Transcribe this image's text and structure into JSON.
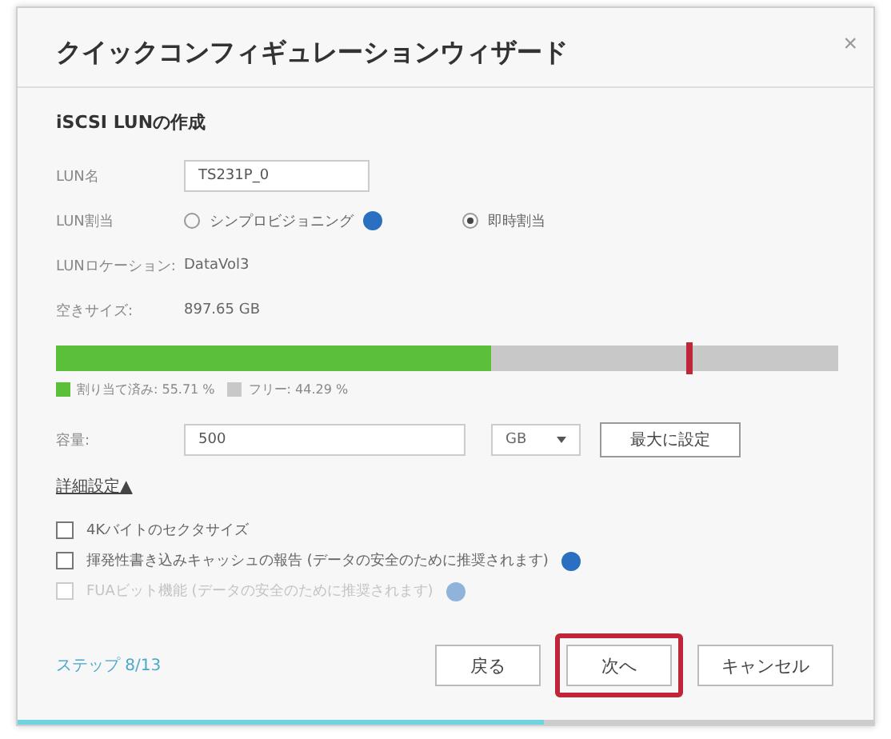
{
  "window": {
    "title": "クイックコンフィギュレーションウィザード",
    "close": "×"
  },
  "section_title": "iSCSI LUNの作成",
  "lun_name": {
    "label": "LUN名",
    "value": "TS231P_0"
  },
  "allocation": {
    "label": "LUN割当",
    "options": [
      {
        "label": "シンプロビジョニング",
        "selected": false,
        "info": true
      },
      {
        "label": "即時割当",
        "selected": true,
        "info": false
      }
    ]
  },
  "location": {
    "label": "LUNロケーション:",
    "value": "DataVol3"
  },
  "free_size": {
    "label": "空きサイズ:",
    "value": "897.65 GB"
  },
  "storage_bar": {
    "level": 0.5571,
    "marker": {
      "level": 0.805
    }
  },
  "legend": [
    {
      "label": "割り当て済み: 55.71 %",
      "color": "#5cbf3a"
    },
    {
      "label": "フリー: 44.29 %",
      "color": "#c8c8c8"
    }
  ],
  "capacity": {
    "label": "容量:",
    "value": "500",
    "unit": "GB",
    "max_button": "最大に設定"
  },
  "advanced": {
    "label": "詳細設定▲"
  },
  "options": [
    {
      "label": "4Kバイトのセクタサイズ",
      "checked": false,
      "disabled": false,
      "info": false
    },
    {
      "label": "揮発性書き込みキャッシュの報告 (データの安全のために推奨されます)",
      "checked": false,
      "disabled": false,
      "info": true
    },
    {
      "label": "FUAビット機能 (データの安全のために推奨されます)",
      "checked": false,
      "disabled": true,
      "info": true
    }
  ],
  "step": "ステップ 8/13",
  "buttons": [
    {
      "label": "戻る",
      "highlighted": false
    },
    {
      "label": "次へ",
      "highlighted": true
    },
    {
      "label": "キャンセル",
      "highlighted": false
    }
  ],
  "step_progress": {
    "level": 0.615
  }
}
